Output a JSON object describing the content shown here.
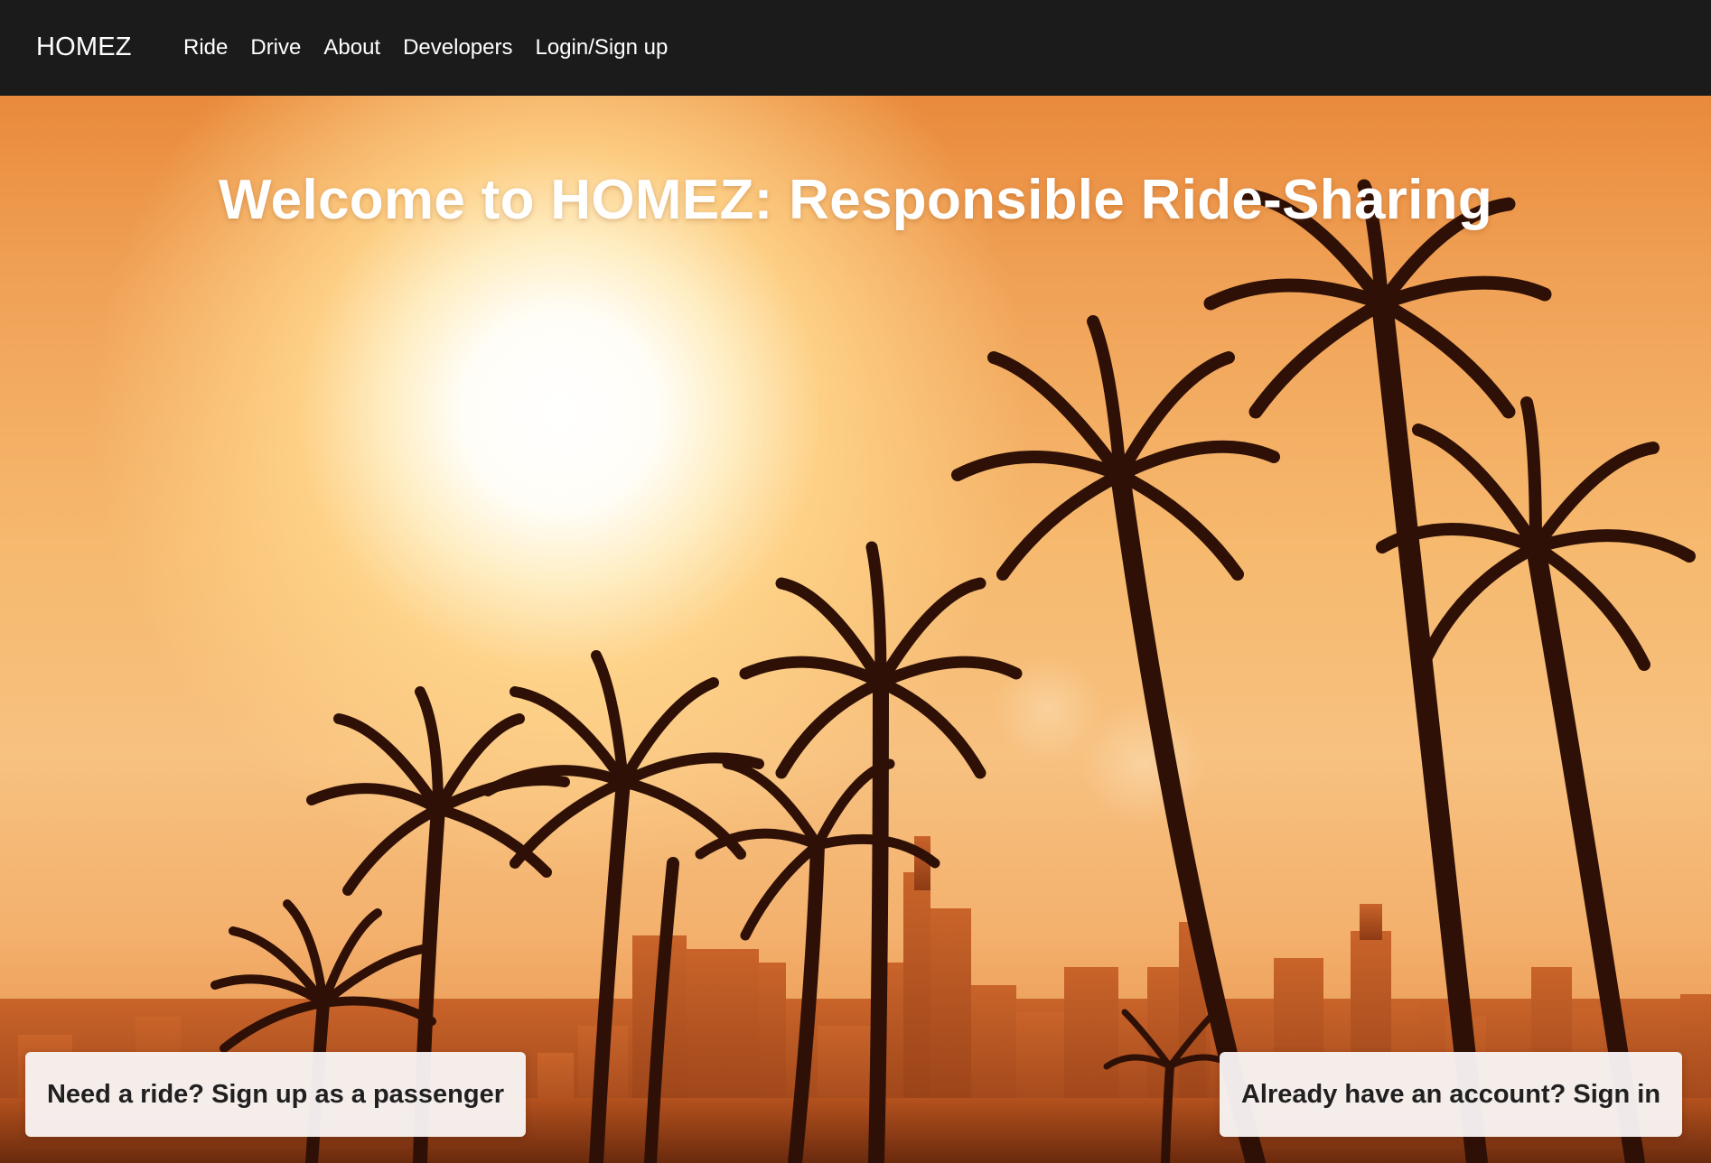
{
  "navbar": {
    "brand": "HOMEZ",
    "links": [
      "Ride",
      "Drive",
      "About",
      "Developers",
      "Login/Sign up"
    ]
  },
  "hero": {
    "title": "Welcome to HOMEZ: Responsible Ride-Sharing",
    "background_image": "sunset-palm-trees-city-skyline",
    "cta_passenger": "Need a ride? Sign up as a passenger",
    "cta_signin": "Already have an account? Sign in"
  },
  "colors": {
    "navbar_bg": "#1b1b1b",
    "nav_text": "#ffffff",
    "sky_orange": "#f0a257",
    "silhouette": "#2a0f06",
    "button_bg": "#f8f4f2"
  }
}
